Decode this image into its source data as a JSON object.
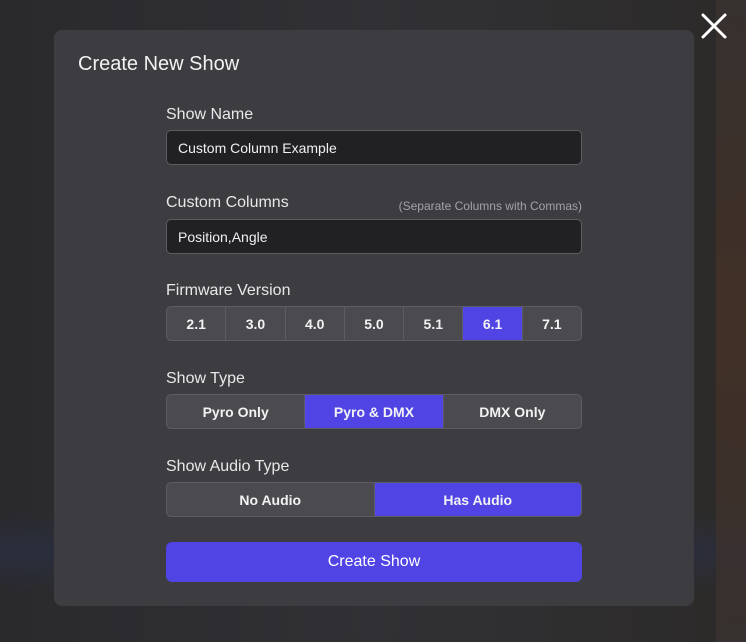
{
  "modal": {
    "title": "Create New Show"
  },
  "show_name": {
    "label": "Show Name",
    "value": "Custom Column Example"
  },
  "custom_columns": {
    "label": "Custom Columns",
    "hint": "(Separate Columns with Commas)",
    "value": "Position,Angle"
  },
  "firmware": {
    "label": "Firmware Version",
    "options": [
      "2.1",
      "3.0",
      "4.0",
      "5.0",
      "5.1",
      "6.1",
      "7.1"
    ],
    "selected": "6.1"
  },
  "show_type": {
    "label": "Show Type",
    "options": [
      "Pyro Only",
      "Pyro & DMX",
      "DMX Only"
    ],
    "selected": "Pyro & DMX"
  },
  "audio_type": {
    "label": "Show Audio Type",
    "options": [
      "No Audio",
      "Has Audio"
    ],
    "selected": "Has Audio"
  },
  "create_button": {
    "label": "Create Show"
  },
  "colors": {
    "accent": "#5045e4",
    "annotation_arrow": "#e0281b"
  },
  "icons": {
    "close": "close-icon",
    "annotation": "arrow-right-icon"
  }
}
